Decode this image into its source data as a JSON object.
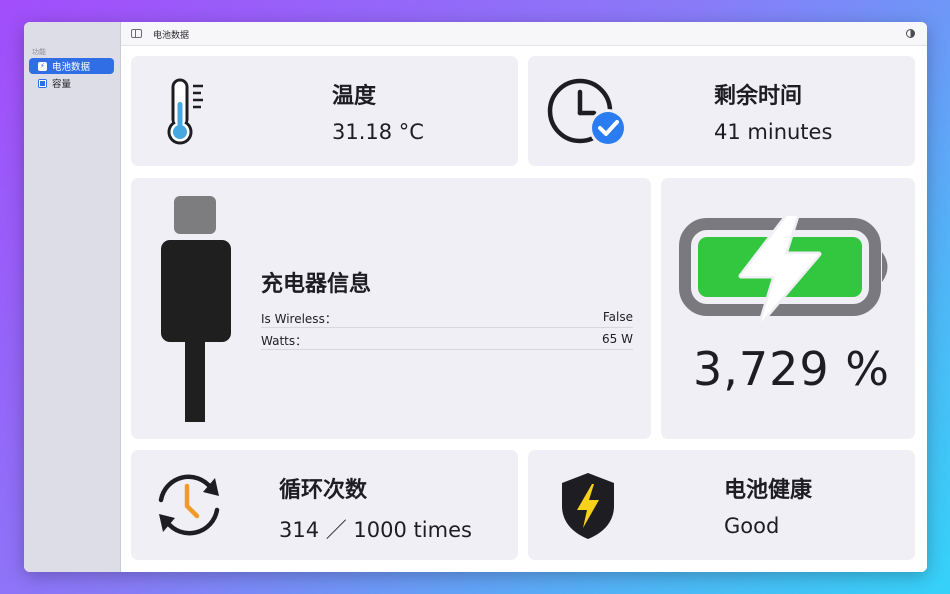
{
  "sidebar": {
    "section_label": "功能",
    "items": [
      {
        "label": "电池数据",
        "icon": "bolt-icon",
        "active": true
      },
      {
        "label": "容量",
        "icon": "square-icon",
        "active": false
      }
    ]
  },
  "toolbar": {
    "title": "电池数据"
  },
  "temperature": {
    "title": "温度",
    "value": "31.18 °C"
  },
  "remaining": {
    "title": "剩余时间",
    "value": "41 minutes"
  },
  "charger": {
    "title": "充电器信息",
    "rows": [
      {
        "label": "Is Wireless：",
        "value": "False"
      },
      {
        "label": "Watts：",
        "value": "65 W"
      }
    ]
  },
  "battery": {
    "percent": "3,729 %",
    "fill_color": "#33c63f"
  },
  "cycles": {
    "title": "循环次数",
    "value": "314 ／ 1000 times"
  },
  "health": {
    "title": "电池健康",
    "value": "Good"
  },
  "colors": {
    "accent": "#2f6ee5",
    "check": "#2b7cf0",
    "thermo": "#46a8e0",
    "bolt": "#f7d11a",
    "clock_hand": "#f19a2a"
  }
}
